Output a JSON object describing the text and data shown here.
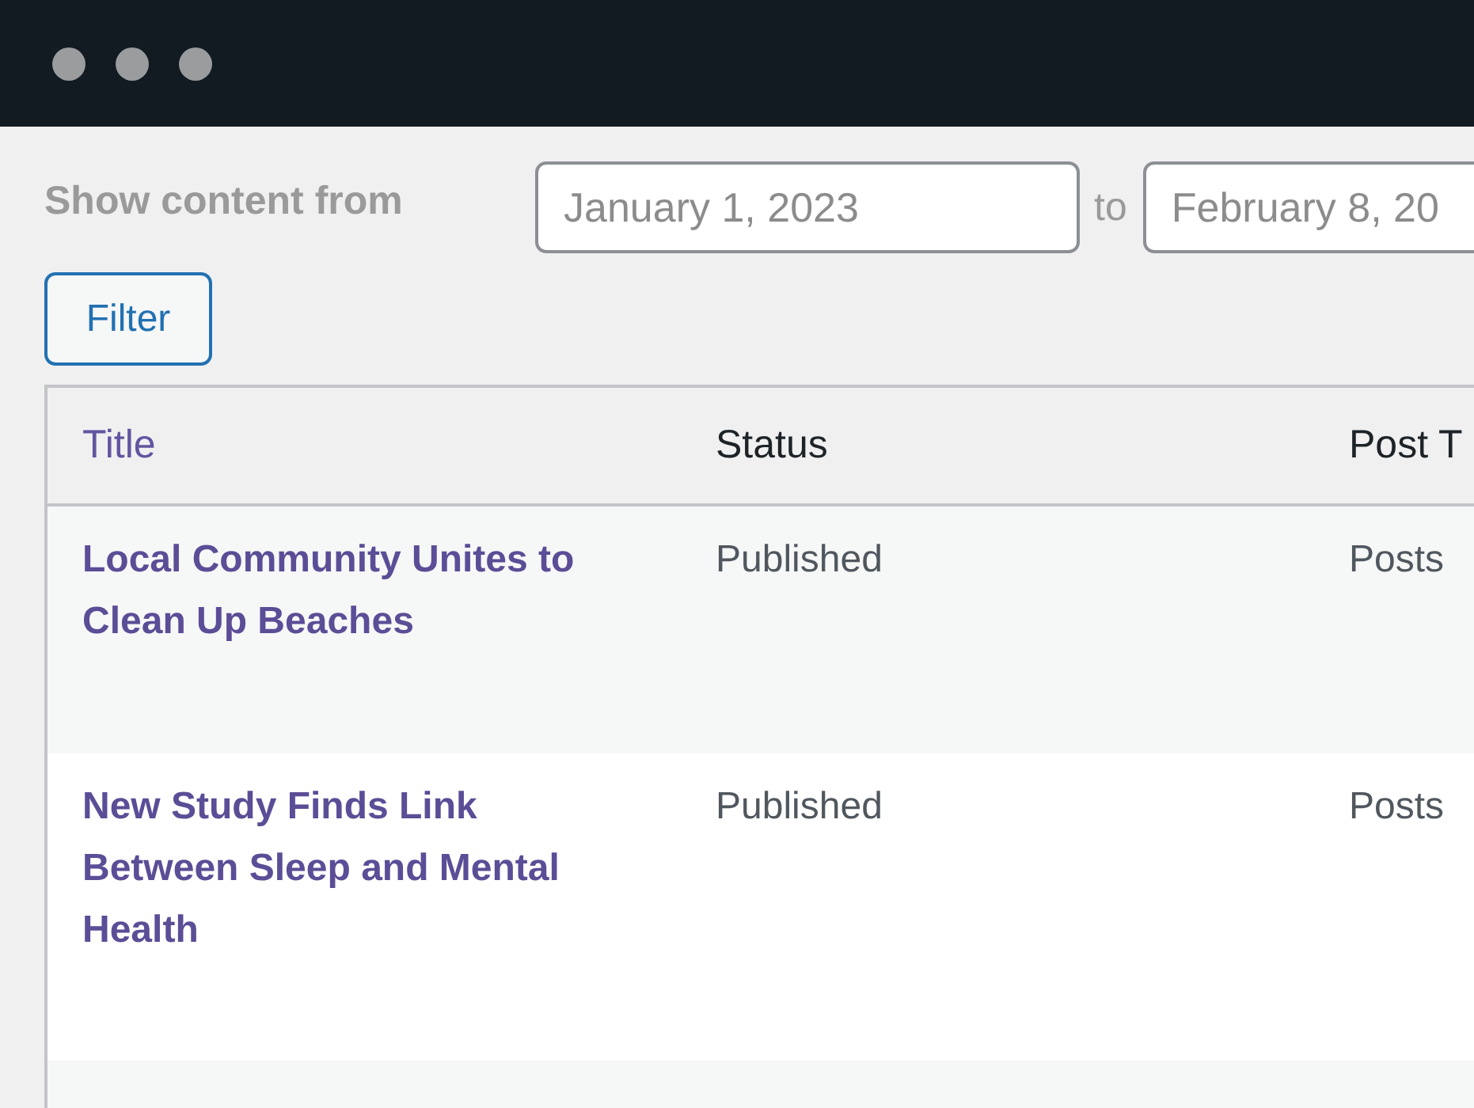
{
  "filter": {
    "label": "Show content from",
    "from": "January 1, 2023",
    "separator": "to",
    "to": "February 8, 20",
    "button": "Filter"
  },
  "table": {
    "columns": [
      "Title",
      "Status",
      "Post T"
    ],
    "rows": [
      {
        "title": "Local Community Unites to Clean Up Beaches",
        "status": "Published",
        "post_type": "Posts"
      },
      {
        "title": "New Study Finds Link Between Sleep and Mental Health",
        "status": "Published",
        "post_type": "Posts"
      }
    ]
  }
}
